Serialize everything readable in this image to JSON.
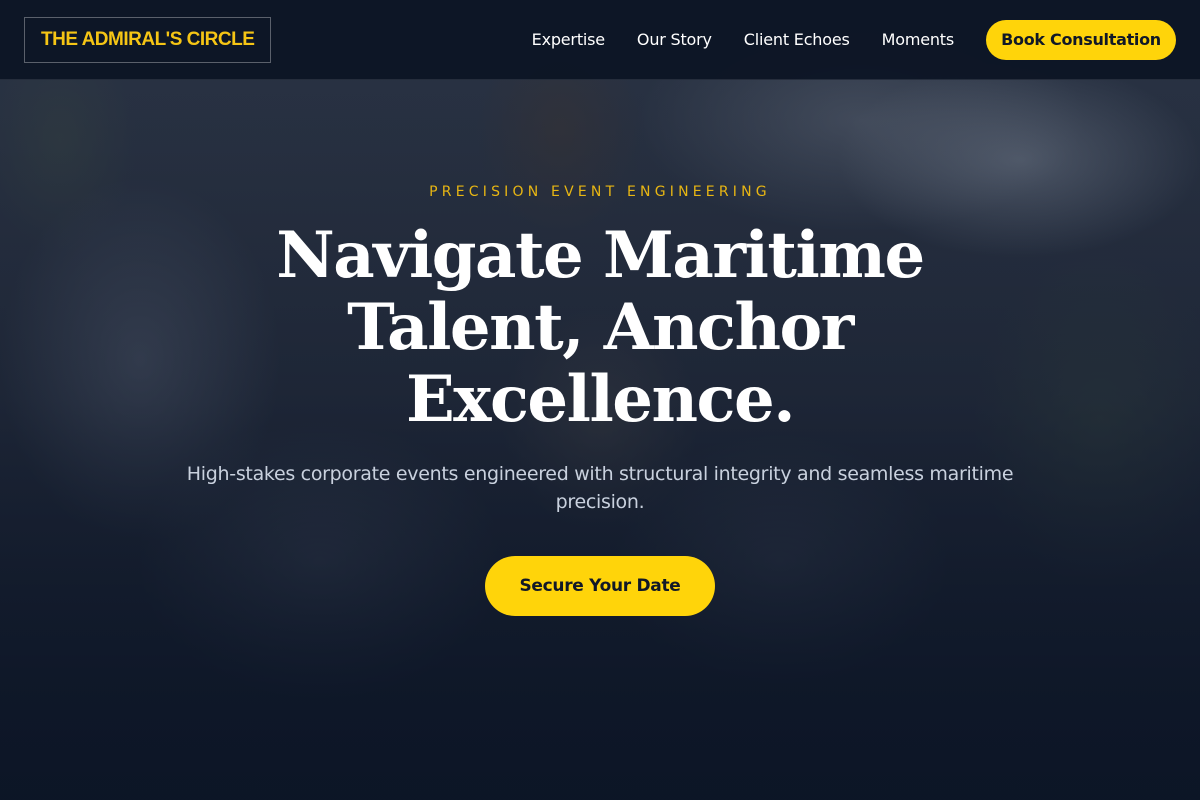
{
  "brand": {
    "name": "THE ADMIRAL'S CIRCLE",
    "accent_color": "#ffd40a"
  },
  "nav": {
    "links": [
      "Expertise",
      "Our Story",
      "Client Echoes",
      "Moments"
    ],
    "cta_label": "Book Consultation"
  },
  "hero": {
    "eyebrow": "PRECISION EVENT ENGINEERING",
    "headline": "Navigate Maritime Talent, Anchor Excellence.",
    "subtext": "High-stakes corporate events engineered with structural integrity and seamless maritime precision.",
    "cta_label": "Secure Your Date"
  }
}
